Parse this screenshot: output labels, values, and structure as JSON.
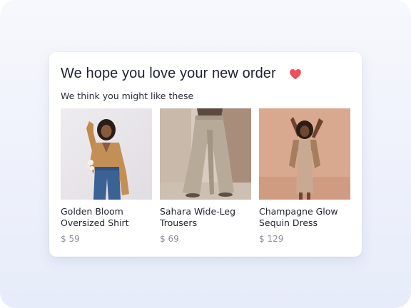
{
  "card": {
    "title": "We hope you love your new order",
    "subtitle": "We think you might like these",
    "heart_icon": "heart-icon",
    "heart_color": "#ef4e5a"
  },
  "products": [
    {
      "name_line1": "Golden Bloom",
      "name_line2": "Oversized Shirt",
      "price": "$ 59",
      "image": "woman-in-mustard-shirt-and-jeans-photo"
    },
    {
      "name_line1": "Sahara Wide-Leg",
      "name_line2": "Trousers",
      "price": "$ 69",
      "image": "wide-leg-beige-trousers-photo"
    },
    {
      "name_line1": "Champagne Glow",
      "name_line2": "Sequin Dress",
      "price": "$ 129",
      "image": "woman-in-champagne-dress-photo"
    }
  ]
}
